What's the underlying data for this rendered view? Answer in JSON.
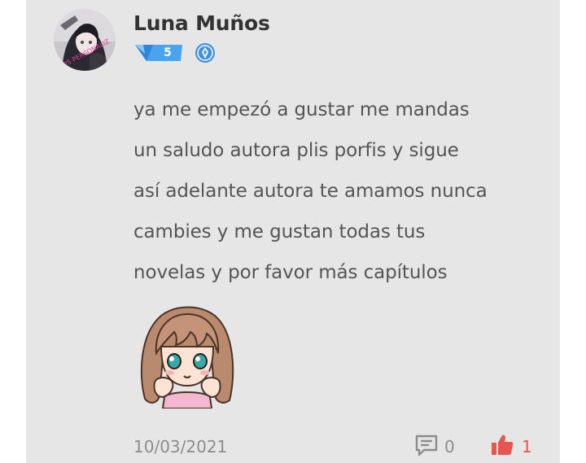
{
  "comment": {
    "author": {
      "name": "Luna Muños",
      "avatar_text": "DDS PERSONALIZ",
      "level": "5",
      "verified_icon": "verified-shield-icon"
    },
    "text_lines": [
      "ya me empezó a gustar me mandas",
      "un saludo autora plis porfis y sigue",
      "así adelante autora te amamos nunca",
      "cambies y me gustan todas tus",
      "novelas y por favor más capítulos"
    ],
    "sticker": "anime-girl-sticker",
    "date": "10/03/2021",
    "reply_count": "0",
    "like_count": "1"
  },
  "colors": {
    "card_background": "#e6e6e6",
    "text": "#555555",
    "username": "#333333",
    "meta": "#8c8c8c",
    "like": "#e8554e",
    "level_badge": "#4aa3ee"
  }
}
